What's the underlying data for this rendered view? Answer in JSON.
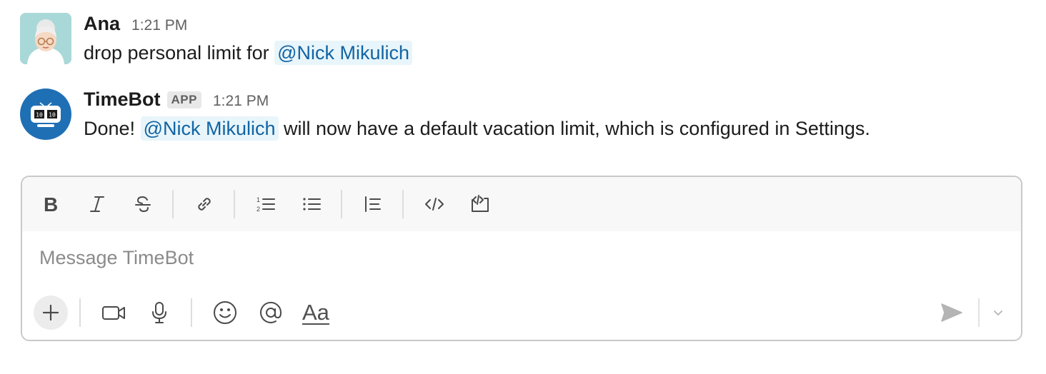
{
  "messages": [
    {
      "sender": "Ana",
      "time": "1:21 PM",
      "text_before": "drop personal limit for ",
      "mention": "@Nick Mikulich",
      "text_after": ""
    },
    {
      "sender": "TimeBot",
      "badge": "APP",
      "time": "1:21 PM",
      "text_before": "Done! ",
      "mention": "@Nick Mikulich",
      "text_after": " will now have a default vacation limit, which is configured in Settings."
    }
  ],
  "composer": {
    "placeholder": "Message TimeBot",
    "format_toolbar": [
      "bold-icon",
      "italic-icon",
      "strikethrough-icon",
      "link-icon",
      "ordered-list-icon",
      "bulleted-list-icon",
      "blockquote-icon",
      "code-icon",
      "code-block-icon"
    ],
    "bottom_toolbar": [
      "plus-icon",
      "video-icon",
      "microphone-icon",
      "emoji-icon",
      "mention-icon",
      "formatting-icon"
    ],
    "formatting_label": "Aa",
    "send": "send-icon",
    "send_options": "chevron-down-icon"
  },
  "colors": {
    "mention_text": "#1264a3",
    "mention_bg": "#e8f5fa",
    "bot_avatar": "#1f6fb5"
  }
}
